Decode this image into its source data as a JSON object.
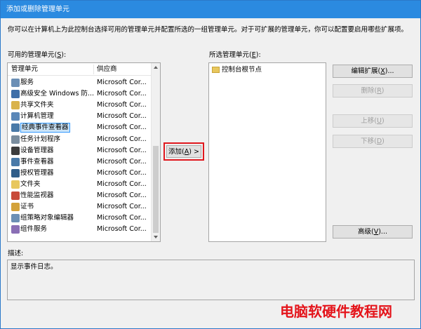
{
  "window": {
    "title": "添加或删除管理单元",
    "description": "你可以在计算机上为此控制台选择可用的管理单元并配置所选的一组管理单元。对于可扩展的管理单元，你可以配置要启用哪些扩展项。"
  },
  "available": {
    "label": "可用的管理单元(",
    "label_key": "S",
    "label_end": "):",
    "col_name": "管理单元",
    "col_vendor": "供应商",
    "items": [
      {
        "name": "服务",
        "vendor": "Microsoft Cor...",
        "icon": "gear-icon",
        "color": "#6b8fb5"
      },
      {
        "name": "高级安全 Windows 防...",
        "vendor": "Microsoft Cor...",
        "icon": "firewall-icon",
        "color": "#3f6fa8"
      },
      {
        "name": "共享文件夹",
        "vendor": "Microsoft Cor...",
        "icon": "shared-folder-icon",
        "color": "#d9b34b"
      },
      {
        "name": "计算机管理",
        "vendor": "Microsoft Cor...",
        "icon": "computer-icon",
        "color": "#5a87b8"
      },
      {
        "name": "经典事件查看器",
        "vendor": "Microsoft Cor...",
        "icon": "event-viewer-icon",
        "color": "#4a7aa8"
      },
      {
        "name": "任务计划程序",
        "vendor": "Microsoft Cor...",
        "icon": "clock-icon",
        "color": "#7a8d9e"
      },
      {
        "name": "设备管理器",
        "vendor": "Microsoft Cor...",
        "icon": "device-icon",
        "color": "#3c3c3c"
      },
      {
        "name": "事件查看器",
        "vendor": "Microsoft Cor...",
        "icon": "event-viewer-icon",
        "color": "#4a7aa8"
      },
      {
        "name": "授权管理器",
        "vendor": "Microsoft Cor...",
        "icon": "authorization-icon",
        "color": "#2f5d8a"
      },
      {
        "name": "文件夹",
        "vendor": "Microsoft Cor...",
        "icon": "folder-icon",
        "color": "#e8c75d"
      },
      {
        "name": "性能监视器",
        "vendor": "Microsoft Cor...",
        "icon": "monitor-icon",
        "color": "#c84b3a"
      },
      {
        "name": "证书",
        "vendor": "Microsoft Cor...",
        "icon": "certificate-icon",
        "color": "#d3a23a"
      },
      {
        "name": "组策略对象编辑器",
        "vendor": "Microsoft Cor...",
        "icon": "policy-icon",
        "color": "#6b8fb5"
      },
      {
        "name": "组件服务",
        "vendor": "Microsoft Cor...",
        "icon": "component-icon",
        "color": "#8a6fb5"
      }
    ],
    "selected_index": 4
  },
  "add_button": {
    "label": "添加(",
    "key": "A",
    "end": ") >"
  },
  "selected": {
    "label": "所选管理单元(",
    "label_key": "E",
    "label_end": "):",
    "root": "控制台根节点"
  },
  "buttons": {
    "edit_ext": {
      "label": "编辑扩展(",
      "key": "X",
      "end": ")..."
    },
    "remove": {
      "label": "删除(",
      "key": "R",
      "end": ")"
    },
    "move_up": {
      "label": "上移(",
      "key": "U",
      "end": ")"
    },
    "move_down": {
      "label": "下移(",
      "key": "D",
      "end": ")"
    },
    "advanced": {
      "label": "高级(",
      "key": "V",
      "end": ")..."
    }
  },
  "description_section": {
    "label": "描述:",
    "text": "显示事件日志。"
  },
  "watermark": "电脑软硬件教程网"
}
